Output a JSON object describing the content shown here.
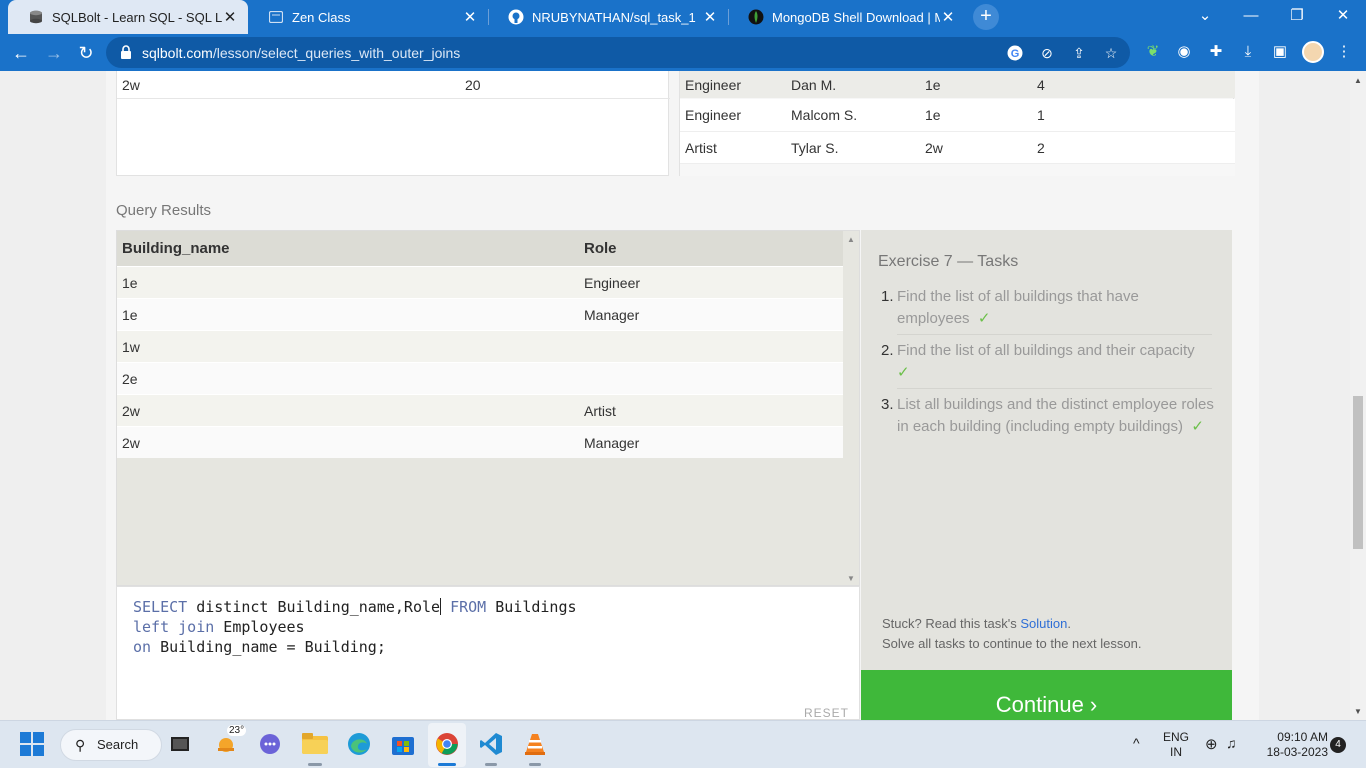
{
  "browser": {
    "tabs": [
      {
        "title": "SQLBolt - Learn SQL - SQL Lesso",
        "active": true,
        "icon": "sqlbolt-icon"
      },
      {
        "title": "Zen Class",
        "active": false,
        "icon": "page-icon"
      },
      {
        "title": "NRUBYNATHAN/sql_task_1",
        "active": false,
        "icon": "github-icon"
      },
      {
        "title": "MongoDB Shell Download | Mon",
        "active": false,
        "icon": "mongodb-icon"
      }
    ],
    "close_glyph": "✕",
    "new_tab_glyph": "+",
    "url_host": "sqlbolt.com",
    "url_path": "/lesson/select_queries_with_outer_joins",
    "window_controls": {
      "dropdown": "⌄",
      "minimize": "—",
      "restore": "❐",
      "close": "✕"
    }
  },
  "top_tables": {
    "left_rows": [
      {
        "building": "2w",
        "capacity": "20"
      }
    ],
    "right_rows": [
      {
        "role": "Engineer",
        "name": "Dan M.",
        "building": "1e",
        "years": "4"
      },
      {
        "role": "Engineer",
        "name": "Malcom S.",
        "building": "1e",
        "years": "1"
      },
      {
        "role": "Artist",
        "name": "Tylar S.",
        "building": "2w",
        "years": "2"
      }
    ]
  },
  "query_results": {
    "label": "Query Results",
    "columns": [
      "Building_name",
      "Role"
    ],
    "rows": [
      [
        "1e",
        "Engineer"
      ],
      [
        "1e",
        "Manager"
      ],
      [
        "1w",
        ""
      ],
      [
        "2e",
        ""
      ],
      [
        "2w",
        "Artist"
      ],
      [
        "2w",
        "Manager"
      ]
    ]
  },
  "editor": {
    "line1_kw1": "SELECT",
    "line1_mid": " distinct Building_name,Role",
    "line1_kw2": " FROM",
    "line1_end": " Buildings",
    "line2_kw1": "left join",
    "line2_end": " Employees",
    "line3_kw1": "on",
    "line3_end": " Building_name = Building;",
    "reset_label": "RESET"
  },
  "exercise": {
    "title": "Exercise 7 — Tasks",
    "tasks": [
      {
        "num": "1.",
        "text": "Find the list of all buildings that have employees",
        "check": "✓"
      },
      {
        "num": "2.",
        "text": "Find the list of all buildings and their capacity",
        "check": "✓"
      },
      {
        "num": "3.",
        "text": "List all buildings and the distinct employee roles in each building (including empty buildings)",
        "check": "✓"
      }
    ],
    "stuck_prefix": "Stuck? Read this task's ",
    "solution_link": "Solution",
    "stuck_suffix": ".",
    "solve_all": "Solve all tasks to continue to the next lesson.",
    "continue_label": "Continue ›"
  },
  "taskbar": {
    "search_label": "Search",
    "weather": "23°",
    "lang_top": "ENG",
    "lang_bottom": "IN",
    "time": "09:10 AM",
    "date": "18-03-2023",
    "notifications": "4",
    "tray_chevron": "^"
  },
  "colors": {
    "chrome_blue": "#1a72c9",
    "continue_green": "#3fb83a",
    "check_green": "#6cc04a",
    "link_blue": "#2f6fd6",
    "sql_keyword": "#5b6fa8"
  }
}
